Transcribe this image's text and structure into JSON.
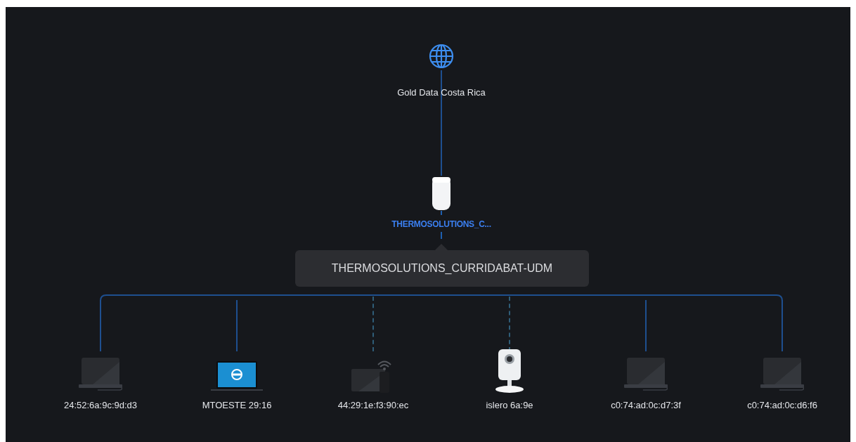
{
  "internet": {
    "label": "Gold Data Costa Rica"
  },
  "gateway": {
    "label": "THERMOSOLUTIONS_C...",
    "tooltip": "THERMOSOLUTIONS_CURRIDABAT-UDM"
  },
  "clients": [
    {
      "label": "24:52:6a:9c:9d:d3",
      "kind": "laptop",
      "wireless": false
    },
    {
      "label": "MTOESTE 29:16",
      "kind": "blue-laptop",
      "wireless": false
    },
    {
      "label": "44:29:1e:f3:90:ec",
      "kind": "wireless-bridge",
      "wireless": true
    },
    {
      "label": "islero 6a:9e",
      "kind": "camera",
      "wireless": true
    },
    {
      "label": "c0:74:ad:0c:d7:3f",
      "kind": "laptop",
      "wireless": false
    },
    {
      "label": "c0:74:ad:0c:d6:f6",
      "kind": "laptop",
      "wireless": false
    }
  ]
}
